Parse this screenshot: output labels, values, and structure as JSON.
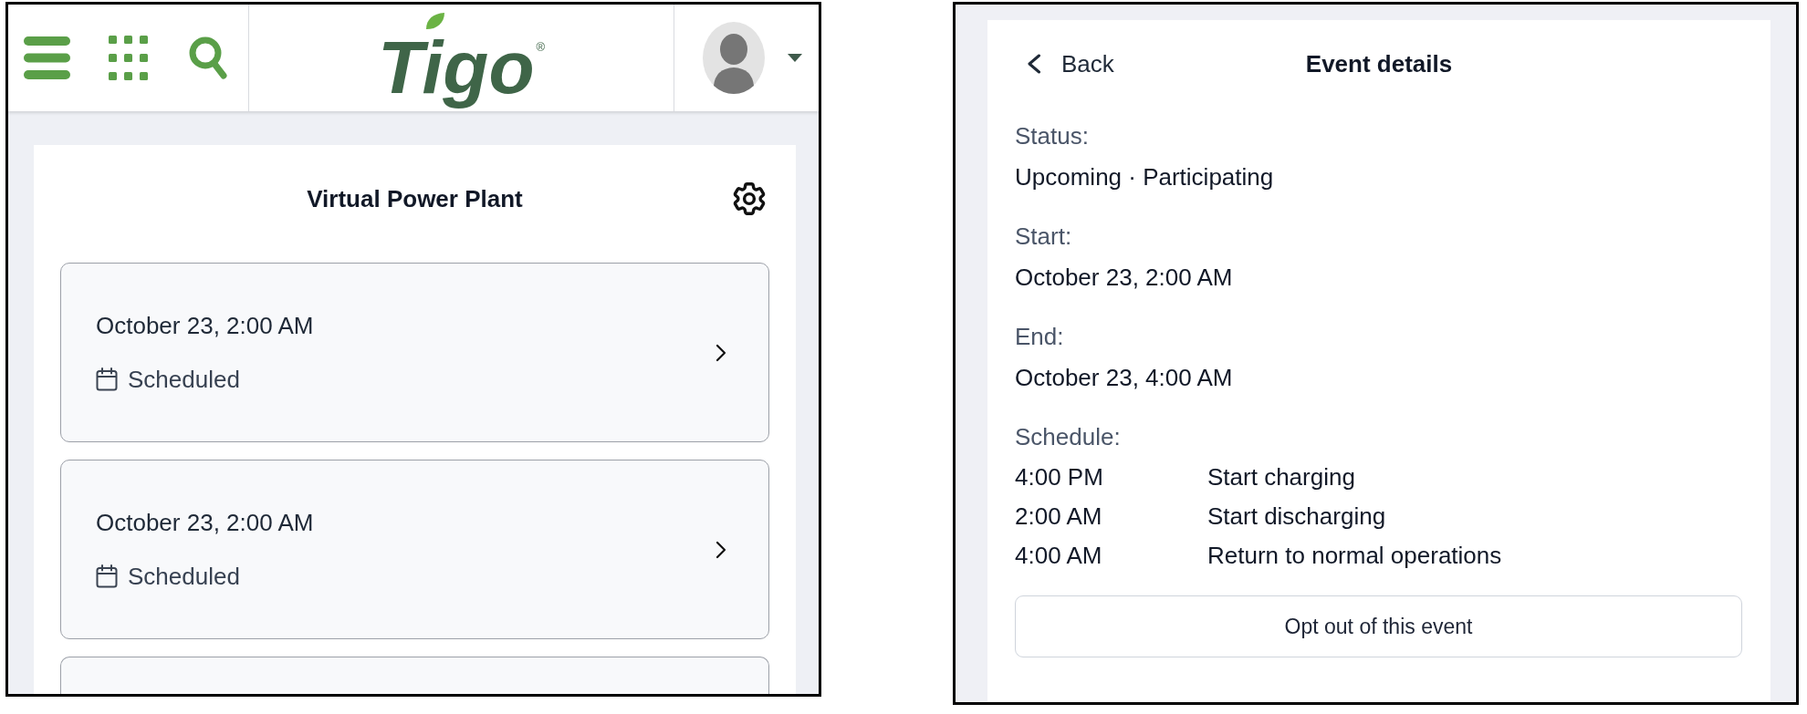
{
  "left_screen": {
    "header": {
      "logo": {
        "text": "Tigo",
        "mark": "®"
      }
    },
    "page_title": "Virtual Power Plant",
    "events": [
      {
        "datetime": "October 23, 2:00 AM",
        "status": "Scheduled",
        "cut_off": false
      },
      {
        "datetime": "October 23, 2:00 AM",
        "status": "Scheduled",
        "cut_off": false
      },
      {
        "cut_off": true
      }
    ]
  },
  "right_screen": {
    "back": "Back",
    "title": "Event details",
    "fields": [
      {
        "label": "Status:",
        "value": "Upcoming · Participating"
      },
      {
        "label": "Start:",
        "value": "October 23, 2:00 AM"
      },
      {
        "label": "End:",
        "value": "October 23, 4:00 AM"
      }
    ],
    "schedule": {
      "label": "Schedule:",
      "rows": [
        {
          "time": "4:00 PM",
          "action": "Start charging"
        },
        {
          "time": "2:00 AM",
          "action": "Start discharging"
        },
        {
          "time": "4:00 AM",
          "action": "Return to normal operations"
        }
      ]
    },
    "opt_out_button": "Opt out of this event"
  }
}
